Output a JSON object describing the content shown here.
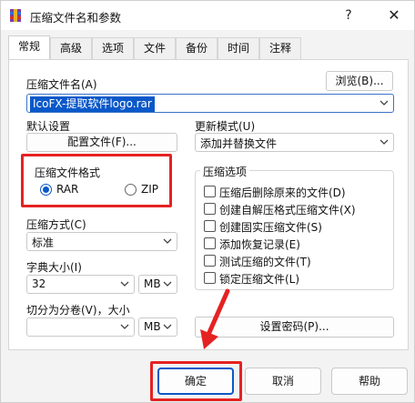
{
  "window": {
    "title": "压缩文件名和参数",
    "help_label": "?",
    "close_label": "✕"
  },
  "tabs": [
    "常规",
    "高级",
    "选项",
    "文件",
    "备份",
    "时间",
    "注释"
  ],
  "archive_name": {
    "label": "压缩文件名(A)",
    "value": "IcoFX-提取软件logo.rar",
    "browse_button": "浏览(B)..."
  },
  "default_settings": {
    "label": "默认设置",
    "profiles_button": "配置文件(F)..."
  },
  "update_mode": {
    "label": "更新模式(U)",
    "value": "添加并替换文件"
  },
  "archive_format": {
    "title": "压缩文件格式",
    "options": [
      {
        "label": "RAR",
        "selected": true
      },
      {
        "label": "ZIP",
        "selected": false
      }
    ]
  },
  "compression_method": {
    "label": "压缩方式(C)",
    "value": "标准"
  },
  "dictionary_size": {
    "label": "字典大小(I)",
    "value": "32",
    "unit": "MB"
  },
  "split_volumes": {
    "label": "切分为分卷(V)，大小",
    "value": "",
    "unit": "MB"
  },
  "archive_options": {
    "title": "压缩选项",
    "items": [
      "压缩后删除原来的文件(D)",
      "创建自解压格式压缩文件(X)",
      "创建固实压缩文件(S)",
      "添加恢复记录(E)",
      "测试压缩的文件(T)",
      "锁定压缩文件(L)"
    ]
  },
  "set_password_button": "设置密码(P)...",
  "footer": {
    "ok": "确定",
    "cancel": "取消",
    "help": "帮助"
  },
  "colors": {
    "highlight": "#0a58c9",
    "annotation_red": "#e52222"
  }
}
